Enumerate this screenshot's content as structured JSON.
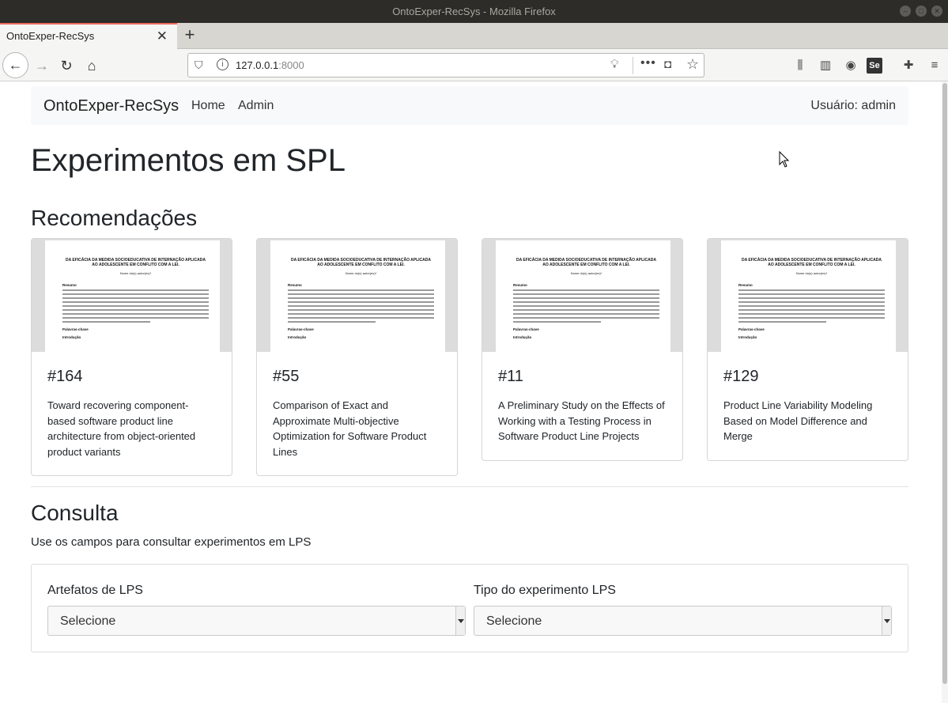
{
  "window": {
    "title": "OntoExper-RecSys - Mozilla Firefox"
  },
  "browser": {
    "tab_title": "OntoExper-RecSys",
    "url_host": "127.0.0.1",
    "url_port": ":8000"
  },
  "nav": {
    "brand": "OntoExper-RecSys",
    "links": [
      "Home",
      "Admin"
    ],
    "user": "Usuário: admin"
  },
  "page": {
    "title": "Experimentos em SPL",
    "recommendations_heading": "Recomendações",
    "query_heading": "Consulta",
    "query_lead": "Use os campos para consultar experimentos em LPS"
  },
  "thumbnail": {
    "title": "DA EFICÁCIA DA MEDIDA SOCIOEDUCATIVA DE INTERNAÇÃO APLICADA AO ADOLESCENTE EM CONFLITO COM A LEI.",
    "author": "Nome do(s) autor(es)*",
    "section": "Resumo",
    "keywords_label": "Palavras-chave",
    "intro": "Introdução"
  },
  "cards": [
    {
      "num": "#164",
      "text": "Toward recovering component-based software product line architecture from object-oriented product variants"
    },
    {
      "num": "#55",
      "text": "Comparison of Exact and Approximate Multi-objective Optimization for Software Product Lines"
    },
    {
      "num": "#11",
      "text": "A Preliminary Study on the Effects of Working with a Testing Process in Software Product Line Projects"
    },
    {
      "num": "#129",
      "text": "Product Line Variability Modeling Based on Model Difference and Merge"
    }
  ],
  "form": {
    "field1_label": "Artefatos de LPS",
    "field1_value": "Selecione",
    "field2_label": "Tipo do experimento LPS",
    "field2_value": "Selecione"
  }
}
